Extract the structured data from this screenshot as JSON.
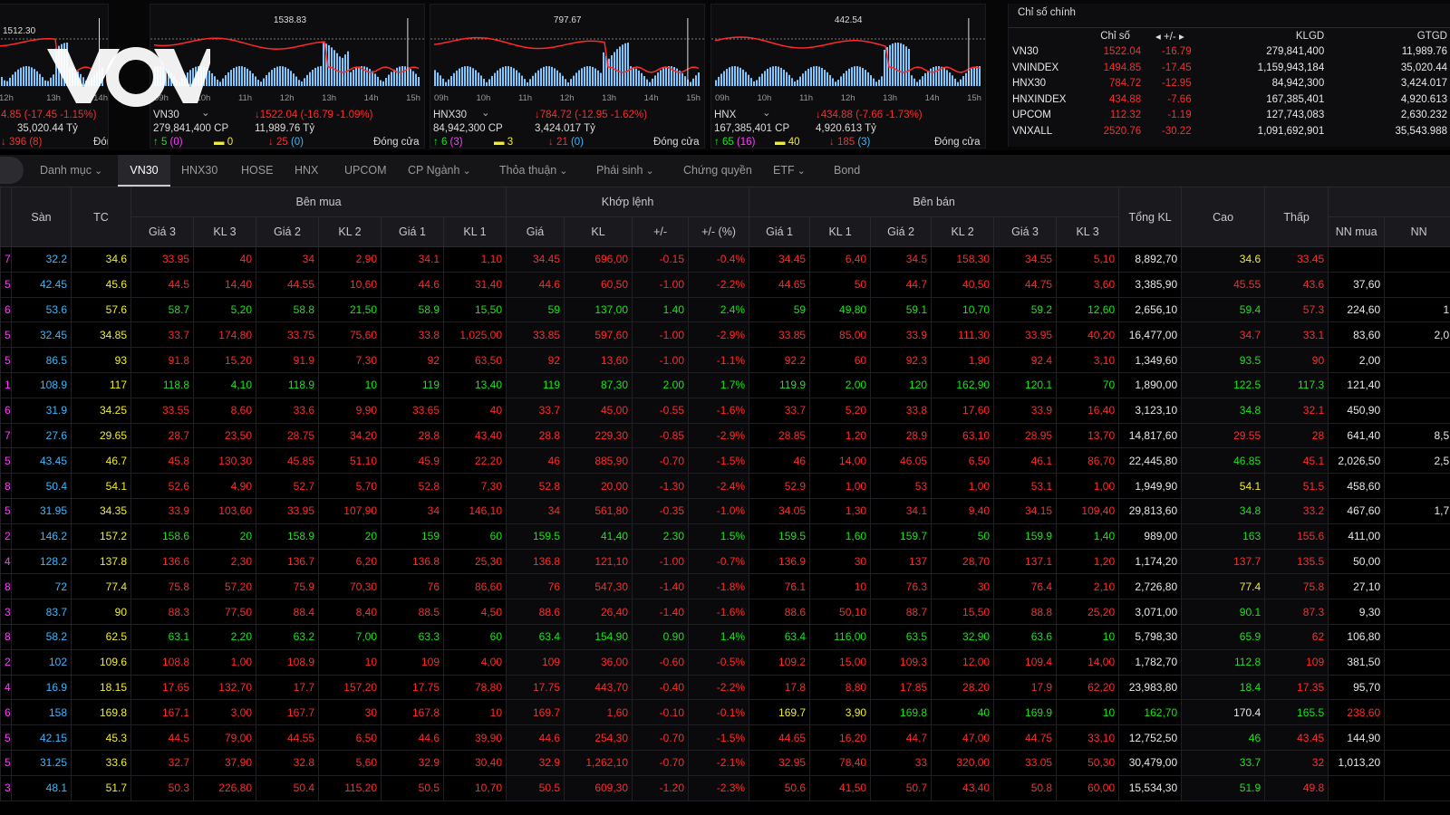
{
  "panels": [
    {
      "peak": "1512.30",
      "times": [
        "12h",
        "13h",
        "14h"
      ],
      "line1": "4.85 (-17.45 -1.15%)",
      "line2": "35,020.44 Tỷ",
      "up": "396 (8)",
      "status": "Đóng cửa"
    },
    {
      "peak": "1538.83",
      "times": [
        "09h",
        "10h",
        "11h",
        "12h",
        "13h",
        "14h",
        "15h"
      ],
      "name": "VN30",
      "vol": "279,841,400 CP",
      "chg": "1522.04 (-16.79 -1.09%)",
      "val": "11,989.76 Tỷ",
      "up": "5",
      "upx": "(0)",
      "ref": "0",
      "down": "25",
      "downx": "(0)",
      "status": "Đóng cửa"
    },
    {
      "peak": "797.67",
      "times": [
        "09h",
        "10h",
        "11h",
        "12h",
        "13h",
        "14h",
        "15h"
      ],
      "name": "HNX30",
      "vol": "84,942,300 CP",
      "chg": "784.72 (-12.95 -1.62%)",
      "val": "3,424.017 Tỷ",
      "up": "6",
      "upx": "(3)",
      "ref": "3",
      "down": "21",
      "downx": "(0)",
      "status": "Đóng cửa"
    },
    {
      "peak": "442.54",
      "times": [
        "09h",
        "10h",
        "11h",
        "12h",
        "13h",
        "14h",
        "15h"
      ],
      "name": "HNX",
      "vol": "167,385,401 CP",
      "chg": "434.88 (-7.66 -1.73%)",
      "val": "4,920.613 Tỷ",
      "up": "65",
      "upx": "(16)",
      "ref": "40",
      "down": "185",
      "downx": "(3)",
      "status": "Đóng cửa"
    }
  ],
  "logo_text": "VOV",
  "index_table": {
    "title": "Chỉ số chính",
    "headers": [
      "Chỉ số",
      "+/-",
      "KLGD",
      "GTGD"
    ],
    "rows": [
      [
        "VN30",
        "1522.04",
        "-16.79",
        "279,841,400",
        "11,989.76"
      ],
      [
        "VNINDEX",
        "1494.85",
        "-17.45",
        "1,159,943,184",
        "35,020.44"
      ],
      [
        "HNX30",
        "784.72",
        "-12.95",
        "84,942,300",
        "3,424.017"
      ],
      [
        "HNXINDEX",
        "434.88",
        "-7.66",
        "167,385,401",
        "4,920.613"
      ],
      [
        "UPCOM",
        "112.32",
        "-1.19",
        "127,743,083",
        "2,630.232"
      ],
      [
        "VNXALL",
        "2520.76",
        "-30.22",
        "1,091,692,901",
        "35,543.988"
      ]
    ]
  },
  "tabs": [
    "Danh mục",
    "VN30",
    "HNX30",
    "HOSE",
    "HNX",
    "UPCOM",
    "CP Ngành",
    "Thỏa thuận",
    "Phái sinh",
    "Chứng quyền",
    "ETF",
    "Bond"
  ],
  "table": {
    "groups": [
      "Bên mua",
      "Khớp lệnh",
      "Bên bán"
    ],
    "single": [
      "Sàn",
      "TC",
      "Tổng KL",
      "Cao",
      "Thấp"
    ],
    "buy": [
      "Giá 3",
      "KL 3",
      "Giá 2",
      "KL 2",
      "Giá 1",
      "KL 1"
    ],
    "match": [
      "Giá",
      "KL",
      "+/-",
      "+/- (%)"
    ],
    "sell": [
      "Giá 1",
      "KL 1",
      "Giá 2",
      "KL 2",
      "Giá 3",
      "KL 3"
    ],
    "nn": [
      "NN mua",
      "NN"
    ],
    "rows": [
      [
        "7",
        "32.2",
        "34.6",
        "33.95",
        "40",
        "34",
        "2,90",
        "34.1",
        "1,10",
        "34.45",
        "696,00",
        "-0.15",
        "-0.4%",
        "34.45",
        "6,40",
        "34.5",
        "158,30",
        "34.55",
        "5,10",
        "8,892,70",
        "34.6",
        "33.45",
        ""
      ],
      [
        "5",
        "42.45",
        "45.6",
        "44.5",
        "14,40",
        "44.55",
        "10,60",
        "44.6",
        "31,40",
        "44.6",
        "60,50",
        "-1.00",
        "-2.2%",
        "44.65",
        "50",
        "44.7",
        "40,50",
        "44.75",
        "3,60",
        "3,385,90",
        "45.55",
        "43.6",
        "37,60"
      ],
      [
        "6",
        "53.6",
        "57.6",
        "58.7",
        "5,20",
        "58.8",
        "21,50",
        "58.9",
        "15,50",
        "59",
        "137,00",
        "1.40",
        "2.4%",
        "59",
        "49,80",
        "59.1",
        "10,70",
        "59.2",
        "12,60",
        "2,656,10",
        "59.4",
        "57.3",
        "224,60"
      ],
      [
        "5",
        "32.45",
        "34.85",
        "33.7",
        "174,80",
        "33.75",
        "75,60",
        "33.8",
        "1,025,00",
        "33.85",
        "597,60",
        "-1.00",
        "-2.9%",
        "33.85",
        "85,00",
        "33.9",
        "111,30",
        "33.95",
        "40,20",
        "16,477,00",
        "34.7",
        "33.1",
        "83,60"
      ],
      [
        "5",
        "86.5",
        "93",
        "91.8",
        "15,20",
        "91.9",
        "7,30",
        "92",
        "63,50",
        "92",
        "13,60",
        "-1.00",
        "-1.1%",
        "92.2",
        "60",
        "92.3",
        "1,90",
        "92.4",
        "3,10",
        "1,349,60",
        "93.5",
        "90",
        "2,00"
      ],
      [
        "1",
        "108.9",
        "117",
        "118.8",
        "4,10",
        "118.9",
        "10",
        "119",
        "13,40",
        "119",
        "87,30",
        "2.00",
        "1.7%",
        "119.9",
        "2,00",
        "120",
        "162,90",
        "120.1",
        "70",
        "1,890,00",
        "122.5",
        "117.3",
        "121,40"
      ],
      [
        "6",
        "31.9",
        "34.25",
        "33.55",
        "8,60",
        "33.6",
        "9,90",
        "33.65",
        "40",
        "33.7",
        "45,00",
        "-0.55",
        "-1.6%",
        "33.7",
        "5,20",
        "33.8",
        "17,60",
        "33.9",
        "16,40",
        "3,123,10",
        "34.8",
        "32.1",
        "450,90"
      ],
      [
        "7",
        "27.6",
        "29.65",
        "28.7",
        "23,50",
        "28.75",
        "34,20",
        "28.8",
        "43,40",
        "28.8",
        "229,30",
        "-0.85",
        "-2.9%",
        "28.85",
        "1,20",
        "28.9",
        "63,10",
        "28.95",
        "13,70",
        "14,817,60",
        "29.55",
        "28",
        "641,40"
      ],
      [
        "5",
        "43.45",
        "46.7",
        "45.8",
        "130,30",
        "45.85",
        "51,10",
        "45.9",
        "22,20",
        "46",
        "885,90",
        "-0.70",
        "-1.5%",
        "46",
        "14,00",
        "46.05",
        "6,50",
        "46.1",
        "86,70",
        "22,445,80",
        "46.85",
        "45.1",
        "2,026,50"
      ],
      [
        "8",
        "50.4",
        "54.1",
        "52.6",
        "4,90",
        "52.7",
        "5,70",
        "52.8",
        "7,30",
        "52.8",
        "20,00",
        "-1.30",
        "-2.4%",
        "52.9",
        "1,00",
        "53",
        "1,00",
        "53.1",
        "1,00",
        "1,949,90",
        "54.1",
        "51.5",
        "458,60"
      ],
      [
        "5",
        "31.95",
        "34.35",
        "33.9",
        "103,60",
        "33.95",
        "107,90",
        "34",
        "146,10",
        "34",
        "561,80",
        "-0.35",
        "-1.0%",
        "34.05",
        "1,30",
        "34.1",
        "9,40",
        "34.15",
        "109,40",
        "29,813,60",
        "34.8",
        "33.2",
        "467,60"
      ],
      [
        "2",
        "146.2",
        "157.2",
        "158.6",
        "20",
        "158.9",
        "20",
        "159",
        "60",
        "159.5",
        "41,40",
        "2.30",
        "1.5%",
        "159.5",
        "1,60",
        "159.7",
        "50",
        "159.9",
        "1,40",
        "989,00",
        "163",
        "155.6",
        "411,00"
      ],
      [
        "4",
        "128.2",
        "137.8",
        "136.6",
        "2,30",
        "136.7",
        "6,20",
        "136.8",
        "25,30",
        "136.8",
        "121,10",
        "-1.00",
        "-0.7%",
        "136.9",
        "30",
        "137",
        "28,70",
        "137.1",
        "1,20",
        "1,174,20",
        "137.7",
        "135.5",
        "50,00"
      ],
      [
        "8",
        "72",
        "77.4",
        "75.8",
        "57,20",
        "75.9",
        "70,30",
        "76",
        "86,60",
        "76",
        "547,30",
        "-1.40",
        "-1.8%",
        "76.1",
        "10",
        "76.3",
        "30",
        "76.4",
        "2,10",
        "2,726,80",
        "77.4",
        "75.8",
        "27,10"
      ],
      [
        "3",
        "83.7",
        "90",
        "88.3",
        "77,50",
        "88.4",
        "8,40",
        "88.5",
        "4,50",
        "88.6",
        "26,40",
        "-1.40",
        "-1.6%",
        "88.6",
        "50,10",
        "88.7",
        "15,50",
        "88.8",
        "25,20",
        "3,071,00",
        "90.1",
        "87.3",
        "9,30"
      ],
      [
        "8",
        "58.2",
        "62.5",
        "63.1",
        "2,20",
        "63.2",
        "7,00",
        "63.3",
        "60",
        "63.4",
        "154,90",
        "0.90",
        "1.4%",
        "63.4",
        "116,00",
        "63.5",
        "32,90",
        "63.6",
        "10",
        "5,798,30",
        "65.9",
        "62",
        "106,80"
      ],
      [
        "2",
        "102",
        "109.6",
        "108.8",
        "1,00",
        "108.9",
        "10",
        "109",
        "4,00",
        "109",
        "36,00",
        "-0.60",
        "-0.5%",
        "109.2",
        "15,00",
        "109.3",
        "12,00",
        "109.4",
        "14,00",
        "1,782,70",
        "112.8",
        "109",
        "381,50"
      ],
      [
        "4",
        "16.9",
        "18.15",
        "17.65",
        "132,70",
        "17.7",
        "157,20",
        "17.75",
        "78,80",
        "17.75",
        "443,70",
        "-0.40",
        "-2.2%",
        "17.8",
        "8,80",
        "17.85",
        "28,20",
        "17.9",
        "62,20",
        "23,983,80",
        "18.4",
        "17.35",
        "95,70"
      ],
      [
        "6",
        "158",
        "169.8",
        "167.1",
        "3,00",
        "167.7",
        "30",
        "167.8",
        "10",
        "169.7",
        "1,60",
        "-0.10",
        "-0.1%",
        "169.7",
        "3,90",
        "169.8",
        "40",
        "169.9",
        "10",
        "162,70",
        "170.4",
        "165.5",
        "238,60"
      ],
      [
        "5",
        "42.15",
        "45.3",
        "44.5",
        "79,00",
        "44.55",
        "6,50",
        "44.6",
        "39,90",
        "44.6",
        "254,30",
        "-0.70",
        "-1.5%",
        "44.65",
        "16,20",
        "44.7",
        "47,00",
        "44.75",
        "33,10",
        "12,752,50",
        "46",
        "43.45",
        "144,90"
      ],
      [
        "5",
        "31.25",
        "33.6",
        "32.7",
        "37,90",
        "32.8",
        "5,60",
        "32.9",
        "30,40",
        "32.9",
        "1,262,10",
        "-0.70",
        "-2.1%",
        "32.95",
        "78,40",
        "33",
        "320,00",
        "33.05",
        "50,30",
        "30,479,00",
        "33.7",
        "32",
        "1,013,20"
      ],
      [
        "3",
        "48.1",
        "51.7",
        "50.3",
        "226,80",
        "50.4",
        "115,20",
        "50.5",
        "10,70",
        "50.5",
        "609,30",
        "-1.20",
        "-2.3%",
        "50.6",
        "41,50",
        "50.7",
        "43,40",
        "50.8",
        "60,00",
        "15,534,30",
        "51.9",
        "49.8",
        ""
      ]
    ],
    "nn2": [
      "",
      "",
      "1",
      "2,0",
      "",
      "",
      "",
      "8,5",
      "2,5",
      "",
      "1,7",
      "",
      "",
      "",
      "",
      "",
      "",
      "",
      "",
      "",
      "",
      ""
    ],
    "colors": [
      "vcyrrrrrrrrrrrrrrrrwyr ",
      "vcyrrrrrrrrrrrrrrrrwrr ",
      "vcyggggggggggggggggwgr ",
      "vcyrrrrrrrrrrrrrrrrwrr ",
      "vcyrrrrrrrrrrrrrrrrwgr ",
      "vcyggggggggggggggggwgg ",
      "vcyrrrrrrrrrrrrrrrrwgr ",
      "vcyrrrrrrrrrrrrrrrrwrr ",
      "vcyrrrrrrrrrrrrrrrrwgr ",
      "vcyrrrrrrrrrrrrrrrrwyr ",
      "vcyrrrrrrrrrrrrrrrrwgr ",
      "vcyggggggggggggggggwgr ",
      "vcyrrrrrrrrrrrrrrrrwrr ",
      "vcyrrrrrrrrrrrrrrrrwyr ",
      "vcyrrrrrrrrrrrrrrrrwgr ",
      "vcyggggggggggggggggwgr ",
      "vcyrrrrrrrrrrrrrrrrwgr ",
      "vcyrrrrrrrrrrrrrrrrwgr ",
      "vcyrrrrrrrrrryygggggwgr ",
      "vcyrrrrrrrrrrrrrrrrwgr ",
      "vcyrrrrrrrrrrrrrrrrwgr ",
      "vcyrrrrrrrrrrrrrrrrwgr "
    ]
  }
}
